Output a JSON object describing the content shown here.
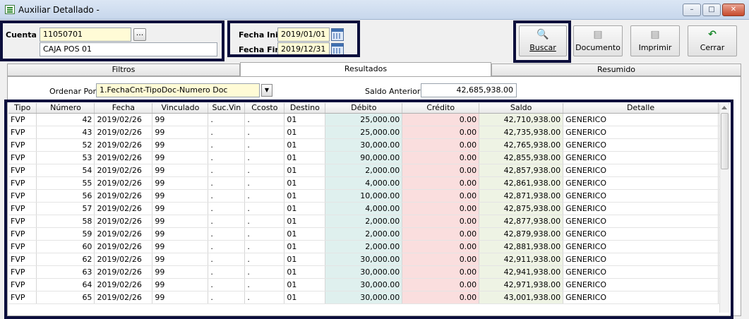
{
  "window": {
    "title": "Auxiliar Detallado -",
    "controls": {
      "minimize": "–",
      "maximize": "□",
      "close": "✕"
    }
  },
  "params": {
    "cuenta_label": "Cuenta :",
    "cuenta_code": "11050701",
    "cuenta_dots": "...",
    "cuenta_name": "CAJA POS 01",
    "fecha_ini_label": "Fecha Ini :",
    "fecha_ini": "2019/01/01",
    "fecha_fin_label": "Fecha Fin :",
    "fecha_fin": "2019/12/31"
  },
  "toolbar": {
    "buscar": {
      "label": "Buscar",
      "icon": "magnifier-document-icon"
    },
    "documento": {
      "label": "Documento",
      "icon": "document-icon"
    },
    "imprimir": {
      "label": "Imprimir",
      "icon": "printer-icon"
    },
    "cerrar": {
      "label": "Cerrar",
      "icon": "undo-arrow-icon"
    }
  },
  "tabs": [
    "Filtros",
    "Resultados",
    "Resumido"
  ],
  "results": {
    "ordenar_label": "Ordenar Por :",
    "ordenar_value": "1.FechaCnt-TipoDoc-Numero Doc",
    "saldo_anterior_label": "Saldo Anterior",
    "saldo_anterior_value": "42,685,938.00"
  },
  "columns": [
    "Tipo",
    "Número",
    "Fecha",
    "Vinculado",
    "Suc.Vin",
    "Ccosto",
    "Destino",
    "Débito",
    "Crédito",
    "Saldo",
    "Detalle"
  ],
  "rows": [
    [
      "FVP",
      "42",
      "2019/02/26",
      "99",
      ".",
      ".",
      "01",
      "25,000.00",
      "0.00",
      "42,710,938.00",
      "GENERICO"
    ],
    [
      "FVP",
      "43",
      "2019/02/26",
      "99",
      ".",
      ".",
      "01",
      "25,000.00",
      "0.00",
      "42,735,938.00",
      "GENERICO"
    ],
    [
      "FVP",
      "52",
      "2019/02/26",
      "99",
      ".",
      ".",
      "01",
      "30,000.00",
      "0.00",
      "42,765,938.00",
      "GENERICO"
    ],
    [
      "FVP",
      "53",
      "2019/02/26",
      "99",
      ".",
      ".",
      "01",
      "90,000.00",
      "0.00",
      "42,855,938.00",
      "GENERICO"
    ],
    [
      "FVP",
      "54",
      "2019/02/26",
      "99",
      ".",
      ".",
      "01",
      "2,000.00",
      "0.00",
      "42,857,938.00",
      "GENERICO"
    ],
    [
      "FVP",
      "55",
      "2019/02/26",
      "99",
      ".",
      ".",
      "01",
      "4,000.00",
      "0.00",
      "42,861,938.00",
      "GENERICO"
    ],
    [
      "FVP",
      "56",
      "2019/02/26",
      "99",
      ".",
      ".",
      "01",
      "10,000.00",
      "0.00",
      "42,871,938.00",
      "GENERICO"
    ],
    [
      "FVP",
      "57",
      "2019/02/26",
      "99",
      ".",
      ".",
      "01",
      "4,000.00",
      "0.00",
      "42,875,938.00",
      "GENERICO"
    ],
    [
      "FVP",
      "58",
      "2019/02/26",
      "99",
      ".",
      ".",
      "01",
      "2,000.00",
      "0.00",
      "42,877,938.00",
      "GENERICO"
    ],
    [
      "FVP",
      "59",
      "2019/02/26",
      "99",
      ".",
      ".",
      "01",
      "2,000.00",
      "0.00",
      "42,879,938.00",
      "GENERICO"
    ],
    [
      "FVP",
      "60",
      "2019/02/26",
      "99",
      ".",
      ".",
      "01",
      "2,000.00",
      "0.00",
      "42,881,938.00",
      "GENERICO"
    ],
    [
      "FVP",
      "62",
      "2019/02/26",
      "99",
      ".",
      ".",
      "01",
      "30,000.00",
      "0.00",
      "42,911,938.00",
      "GENERICO"
    ],
    [
      "FVP",
      "63",
      "2019/02/26",
      "99",
      ".",
      ".",
      "01",
      "30,000.00",
      "0.00",
      "42,941,938.00",
      "GENERICO"
    ],
    [
      "FVP",
      "64",
      "2019/02/26",
      "99",
      ".",
      ".",
      "01",
      "30,000.00",
      "0.00",
      "42,971,938.00",
      "GENERICO"
    ],
    [
      "FVP",
      "65",
      "2019/02/26",
      "99",
      ".",
      ".",
      "01",
      "30,000.00",
      "0.00",
      "43,001,938.00",
      "GENERICO"
    ]
  ],
  "colors": {
    "highlight_border": "#0c0f3c",
    "input_yellow": "#fffbd6",
    "debit_bg": "#dff0ee",
    "credit_bg": "#fadede",
    "balance_bg": "#eef3e4"
  }
}
